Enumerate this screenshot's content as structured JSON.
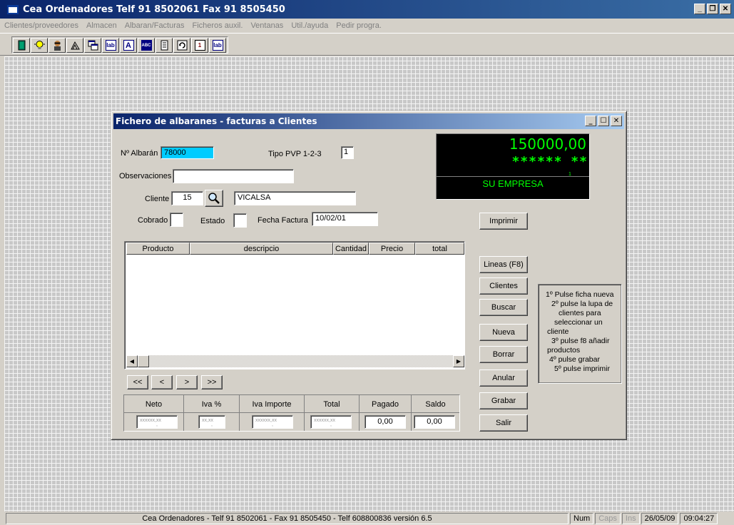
{
  "window": {
    "title": "Cea Ordenadores Telf 91 8502061 Fax 91 8505450"
  },
  "menu": [
    "Clientes/proveedores",
    "Almacen",
    "Albaran/Facturas",
    "Ficheros auxil.",
    "Ventanas",
    "Util./ayuda",
    "Pedir progra."
  ],
  "toolbar": {
    "icons": [
      "exit-door-icon",
      "lightbulb-icon",
      "person-icon",
      "hand-icon",
      "windows-icon",
      "abc-transfer-icon",
      "a-font-icon",
      "abc-dictionary-icon",
      "document-list-icon",
      "refresh-icon",
      "print-preview-icon",
      "abc-transfer-icon-2"
    ],
    "labels": [
      "",
      "",
      "",
      "",
      "",
      "lab",
      "A",
      "ABC",
      "",
      "",
      "1",
      "lab"
    ]
  },
  "child": {
    "title": "Fichero de albaranes - facturas a Clientes",
    "albaran_label": "Nº Albarán",
    "albaran_value": "78000",
    "tipo_pvp_label": "Tipo PVP 1-2-3",
    "tipo_pvp_value": "1",
    "observaciones_label": "Observaciones",
    "observaciones_value": "",
    "cliente_label": "Cliente",
    "cliente_value": "15",
    "cliente_nombre": "VICALSA",
    "cobrado_label": "Cobrado",
    "estado_label": "Estado",
    "fecha_factura_label": "Fecha Factura",
    "fecha_factura_value": "10/02/01",
    "display": {
      "amount": "150000,00",
      "stars": "****** **",
      "small": "1",
      "company": "SU EMPRESA"
    },
    "grid": {
      "columns": [
        "Producto",
        "descripcio",
        "Cantidad",
        "Precio",
        "total"
      ],
      "rows": []
    },
    "nav": [
      "<<",
      "<",
      ">",
      ">>"
    ],
    "totals": {
      "headers": [
        "Neto",
        "Iva %",
        "Iva Importe",
        "Total",
        "Pagado",
        "Saldo"
      ],
      "neto": "xxxxxx,xx",
      "neto_sub": ",",
      "iva_pct": "xx,xx",
      "iva_pct_sub": ",",
      "iva_importe": "xxxxxx,xx",
      "iva_importe_sub": ",",
      "total": "xxxxxx,xx",
      "total_sub": ",",
      "pagado": "0,00",
      "saldo": "0,00"
    },
    "buttons": {
      "imprimir": "Imprimir",
      "lineas": "Lineas (F8)",
      "clientes": "Clientes",
      "buscar": "Buscar",
      "nueva": "Nueva",
      "borrar": "Borrar",
      "anular": "Anular",
      "grabar": "Grabar",
      "salir": "Salir"
    },
    "instructions": [
      "1º Pulse ficha nueva",
      "2º pulse la lupa de",
      "clientes para",
      "seleccionar un",
      "cliente",
      "3º pulse f8 añadir",
      "productos",
      "4º pulse grabar",
      "5º pulse imprimir"
    ]
  },
  "status": {
    "main": "Cea Ordenadores - Telf 91 8502061 - Fax 91 8505450 - Telf 608800836 versión 6.5",
    "num": "Num",
    "caps": "Caps",
    "ins": "Ins",
    "date": "26/05/09",
    "time": "09:04:27"
  }
}
